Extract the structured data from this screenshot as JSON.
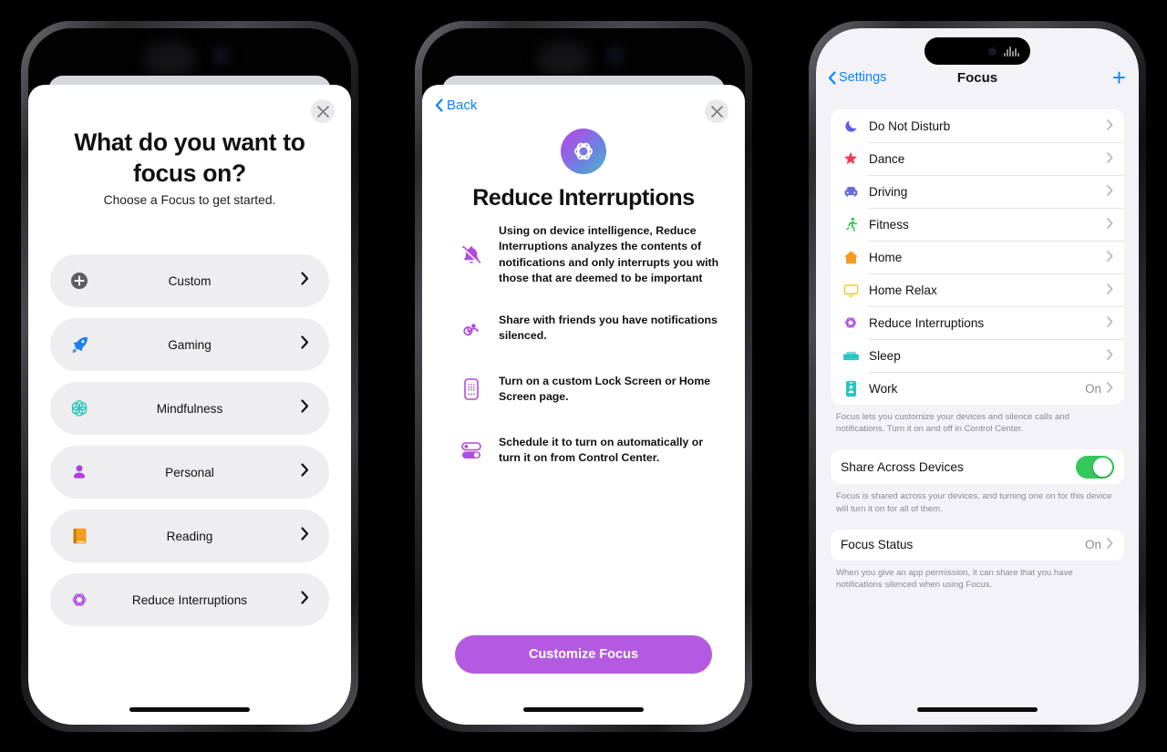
{
  "phone1": {
    "close_label": "close",
    "title": "What do you want to focus on?",
    "subtitle": "Choose a Focus to get started.",
    "items": [
      {
        "label": "Custom",
        "icon": "plus-circle-icon",
        "color": "#5c5c61"
      },
      {
        "label": "Gaming",
        "icon": "rocket-icon",
        "color": "#1c7ef0"
      },
      {
        "label": "Mindfulness",
        "icon": "mindfulness-flower-icon",
        "color": "#28c3b8"
      },
      {
        "label": "Personal",
        "icon": "person-icon",
        "color": "#b03fe0"
      },
      {
        "label": "Reading",
        "icon": "book-icon",
        "color": "#f0a01e"
      },
      {
        "label": "Reduce Interruptions",
        "icon": "reduce-interruptions-icon",
        "color": "#b04ce0"
      }
    ]
  },
  "phone2": {
    "back_label": "Back",
    "close_label": "close",
    "app_icon": "reduce-interruptions-gradient-icon",
    "title": "Reduce Interruptions",
    "features": [
      {
        "icon": "bell-slash-icon",
        "text": "Using on device intelligence, Reduce Interruptions analyzes the contents of notifications and only interrupts you with those that are deemed to be important"
      },
      {
        "icon": "share-person-icon",
        "text": "Share with friends you have notifications silenced."
      },
      {
        "icon": "lock-screen-icon",
        "text": "Turn on a custom Lock Screen or Home Screen page."
      },
      {
        "icon": "toggles-icon",
        "text": "Schedule it to turn on automatically or turn it on from Control Center."
      }
    ],
    "cta_label": "Customize Focus",
    "cta_color": "#b45ae0"
  },
  "phone3": {
    "nav": {
      "back_label": "Settings",
      "title": "Focus",
      "add_label": "+"
    },
    "focus_items": [
      {
        "label": "Do Not Disturb",
        "icon": "moon-icon",
        "color": "#5e5ce6",
        "value": ""
      },
      {
        "label": "Dance",
        "icon": "star-icon",
        "color": "#f03a5a",
        "value": ""
      },
      {
        "label": "Driving",
        "icon": "car-icon",
        "color": "#6b6be0",
        "value": ""
      },
      {
        "label": "Fitness",
        "icon": "running-person-icon",
        "color": "#34c759",
        "value": ""
      },
      {
        "label": "Home",
        "icon": "house-icon",
        "color": "#f59a1e",
        "value": ""
      },
      {
        "label": "Home Relax",
        "icon": "display-icon",
        "color": "#f0c41e",
        "value": ""
      },
      {
        "label": "Reduce Interruptions",
        "icon": "reduce-interruptions-icon",
        "color": "#b04ce0",
        "value": ""
      },
      {
        "label": "Sleep",
        "icon": "bed-icon",
        "color": "#2ac3c3",
        "value": ""
      },
      {
        "label": "Work",
        "icon": "badge-id-icon",
        "color": "#2ac3c3",
        "value": "On"
      }
    ],
    "focus_footnote": "Focus lets you customize your devices and silence calls and notifications. Turn it on and off in Control Center.",
    "share": {
      "label": "Share Across Devices",
      "on": true,
      "on_color": "#34c759",
      "footnote": "Focus is shared across your devices, and turning one on for this device will turn it on for all of them."
    },
    "status": {
      "label": "Focus Status",
      "value": "On",
      "footnote": "When you give an app permission, it can share that you have notifications silenced when using Focus."
    }
  }
}
